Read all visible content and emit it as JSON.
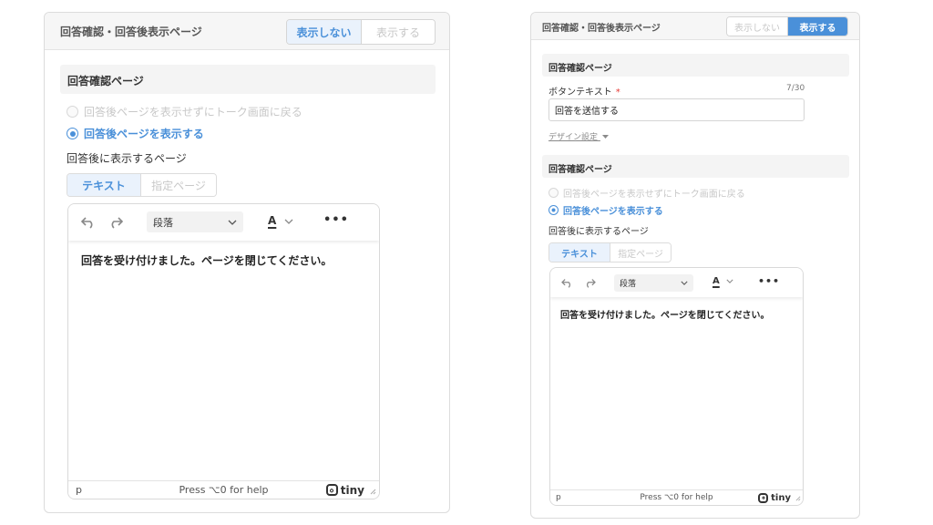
{
  "left": {
    "header_title": "回答確認・回答後表示ページ",
    "toggle": {
      "hide_label": "表示しない",
      "show_label": "表示する",
      "selected": "hide"
    },
    "section_title": "回答確認ページ",
    "radio_options": [
      {
        "label": "回答後ページを表示せずにトーク画面に戻る",
        "selected": false
      },
      {
        "label": "回答後ページを表示する",
        "selected": true
      }
    ],
    "after_page_label": "回答後に表示するページ",
    "tabs": [
      {
        "label": "テキスト",
        "active": true
      },
      {
        "label": "指定ページ",
        "active": false
      }
    ],
    "editor": {
      "block_format": "段落",
      "font_color_glyph": "A",
      "content": "回答を受け付けました。ページを閉じてください。",
      "status_path": "p",
      "help_text": "Press ⌥0 for help",
      "brand": "tiny"
    }
  },
  "right": {
    "header_title": "回答確認・回答後表示ページ",
    "toggle": {
      "hide_label": "表示しない",
      "show_label": "表示する",
      "selected": "show"
    },
    "confirm_section_title": "回答確認ページ",
    "button_text_label": "ボタンテキスト",
    "required_mark": "*",
    "char_counter": "7/30",
    "button_text_value": "回答を送信する",
    "design_settings_label": "デザイン設定",
    "section_title": "回答確認ページ",
    "radio_options": [
      {
        "label": "回答後ページを表示せずにトーク画面に戻る",
        "selected": false
      },
      {
        "label": "回答後ページを表示する",
        "selected": true
      }
    ],
    "after_page_label": "回答後に表示するページ",
    "tabs": [
      {
        "label": "テキスト",
        "active": true
      },
      {
        "label": "指定ページ",
        "active": false
      }
    ],
    "editor": {
      "block_format": "段落",
      "font_color_glyph": "A",
      "content": "回答を受け付けました。ページを閉じてください。",
      "status_path": "p",
      "help_text": "Press ⌥0 for help",
      "brand": "tiny"
    }
  },
  "colors": {
    "accent": "#4a90d9",
    "required": "#e53935",
    "disabled_text": "#c8c8c8"
  },
  "icons": [
    "undo-icon",
    "redo-icon",
    "chevron-down-icon",
    "more-icon",
    "tiny-logo-icon",
    "resize-handle-icon",
    "caret-down-icon"
  ]
}
